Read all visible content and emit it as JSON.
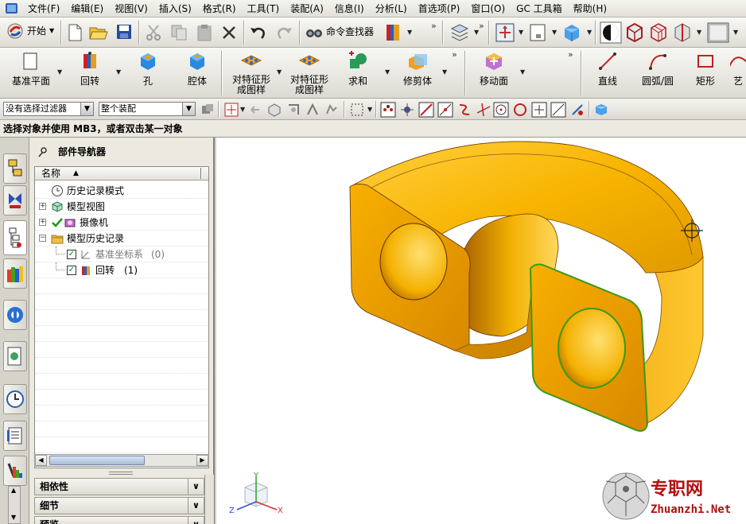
{
  "menubar": {
    "items": [
      "文件(F)",
      "编辑(E)",
      "视图(V)",
      "插入(S)",
      "格式(R)",
      "工具(T)",
      "装配(A)",
      "信息(I)",
      "分析(L)",
      "首选项(P)",
      "窗口(O)",
      "GC 工具箱",
      "帮助(H)"
    ]
  },
  "toolbar1": {
    "start_label": "开始",
    "command_finder_label": "命令查找器"
  },
  "toolbar2": {
    "datum_plane": "基准平面",
    "revolve": "回转",
    "hole": "孔",
    "pocket": "腔体",
    "pattern1_line1": "对特征形",
    "pattern1_line2": "成图样",
    "pattern2_line1": "对特征形",
    "pattern2_line2": "成图样",
    "unite": "求和",
    "trim_body": "修剪体",
    "move_face": "移动面",
    "line": "直线",
    "arc": "圆弧/圆",
    "rectangle": "矩形",
    "art": "艺"
  },
  "filterbar": {
    "type_filter": "没有选择过滤器",
    "scope_filter": "整个装配"
  },
  "status": {
    "prompt": "选择对象并使用 MB3，或者双击某一对象"
  },
  "navigator": {
    "title": "部件导航器",
    "column_name": "名称",
    "tree": [
      {
        "label": "历史记录模式",
        "level": 0
      },
      {
        "label": "模型视图",
        "level": 0
      },
      {
        "label": "摄像机",
        "level": 0
      },
      {
        "label": "模型历史记录",
        "level": 0
      },
      {
        "label": "基准坐标系",
        "suffix": "(0)",
        "level": 1
      },
      {
        "label": "回转",
        "suffix": "(1)",
        "level": 1
      }
    ],
    "sections": [
      "相依性",
      "细节",
      "预览"
    ]
  },
  "viewport": {
    "watermark_cn": "专职网",
    "watermark_en": "Zhuanzhi.Net",
    "axis_x": "X",
    "axis_y": "Y",
    "axis_z": "Z"
  },
  "colors": {
    "part_main": "#f5a800",
    "part_dark": "#c87800",
    "part_light": "#ffd24a",
    "highlight_edge": "#3a9a1a"
  }
}
